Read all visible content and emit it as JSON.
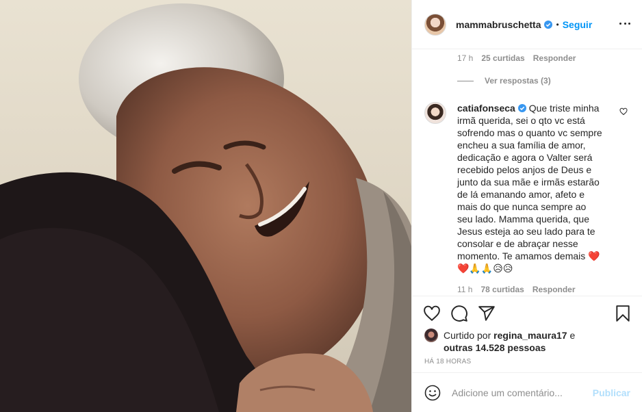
{
  "header": {
    "username": "mammabruschetta",
    "separator": "•",
    "follow_label": "Seguir",
    "verified_icon": "verified-badge-icon",
    "more_icon": "more-options-icon"
  },
  "prev_comment_meta": {
    "time": "17 h",
    "likes": "25 curtidas",
    "reply": "Responder"
  },
  "view_replies": "Ver respostas (3)",
  "comment": {
    "username": "catiafonseca",
    "text": " Que triste minha irmã querida, sei o qto vc está sofrendo mas o quanto vc sempre encheu a sua família de amor, dedicação e agora o Valter será recebido pelos anjos de Deus e junto da sua mãe e irmãs estarão de lá emanando amor, afeto e mais do que nunca sempre ao seu lado. Mamma querida, que Jesus esteja ao seu lado para te consolar e de abraçar nesse momento. Te amamos demais ❤️",
    "emoji_line": "❤️🙏🙏😥😥",
    "time": "11 h",
    "likes": "78 curtidas",
    "reply": "Responder"
  },
  "actions": {
    "like_icon": "heart-icon",
    "comment_icon": "comment-icon",
    "share_icon": "share-icon",
    "save_icon": "bookmark-icon"
  },
  "liked_by": {
    "prefix": "Curtido por ",
    "user": "regina_maura17",
    "middle": " e",
    "others": "outras 14.528 pessoas"
  },
  "timestamp": "HÁ 18 HORAS",
  "add_comment": {
    "placeholder": "Adicione um comentário...",
    "post_label": "Publicar"
  },
  "colors": {
    "accent": "#0095f6",
    "post_disabled": "#b2dffc",
    "heart_red": "#ed4956"
  }
}
